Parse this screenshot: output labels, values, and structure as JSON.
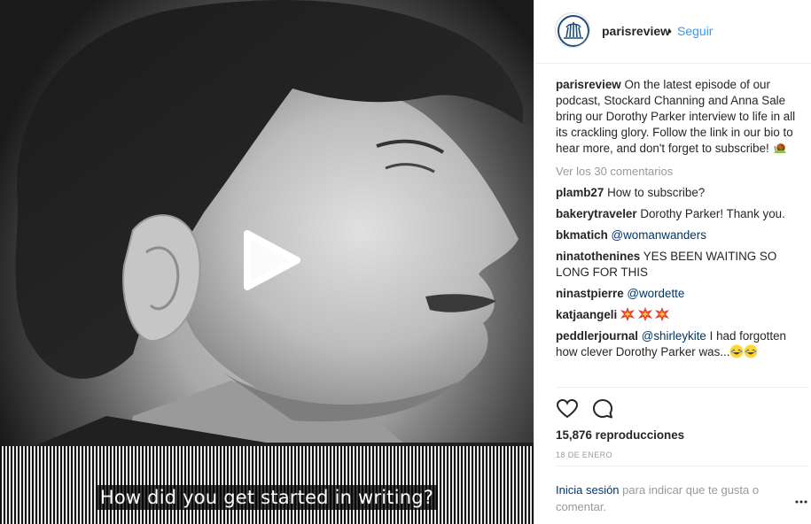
{
  "video": {
    "subtitle": "How did you get started in writing?"
  },
  "header": {
    "username": "parisreview",
    "separator": "•",
    "follow_label": "Seguir"
  },
  "caption": {
    "username": "parisreview",
    "text": "On the latest episode of our podcast, Stockard Channing and Anna Sale bring our Dorothy Parker interview to life in all its crackling glory. Follow the link in our bio to hear more, and don't forget to subscribe!"
  },
  "view_more": "Ver los 30 comentarios",
  "comments": [
    {
      "username": "plamb27",
      "text": "How to subscribe?"
    },
    {
      "username": "bakerytraveler",
      "text": "Dorothy Parker! Thank you."
    },
    {
      "username": "bkmatich",
      "mention": "@womanwanders"
    },
    {
      "username": "ninatothenines",
      "text": "YES BEEN WAITING SO LONG FOR THIS"
    },
    {
      "username": "ninastpierre",
      "mention": "@wordette"
    },
    {
      "username": "katjaangeli"
    },
    {
      "username": "peddlerjournal",
      "mention": "@shirleykite",
      "text": "I had forgotten how clever Dorothy Parker was..."
    }
  ],
  "stats": {
    "views": "15,876 reproducciones",
    "date": "18 DE ENERO"
  },
  "login": {
    "link": "Inicia sesión",
    "text": "para indicar que te gusta o comentar."
  },
  "colors": {
    "link_blue": "#3897f0",
    "mention_blue": "#003569",
    "muted": "#999999",
    "text": "#262626"
  },
  "icons": [
    "play-icon",
    "heart-icon",
    "comment-icon",
    "more-options-icon",
    "snail-emoji",
    "collision-emoji",
    "laughing-emoji"
  ]
}
